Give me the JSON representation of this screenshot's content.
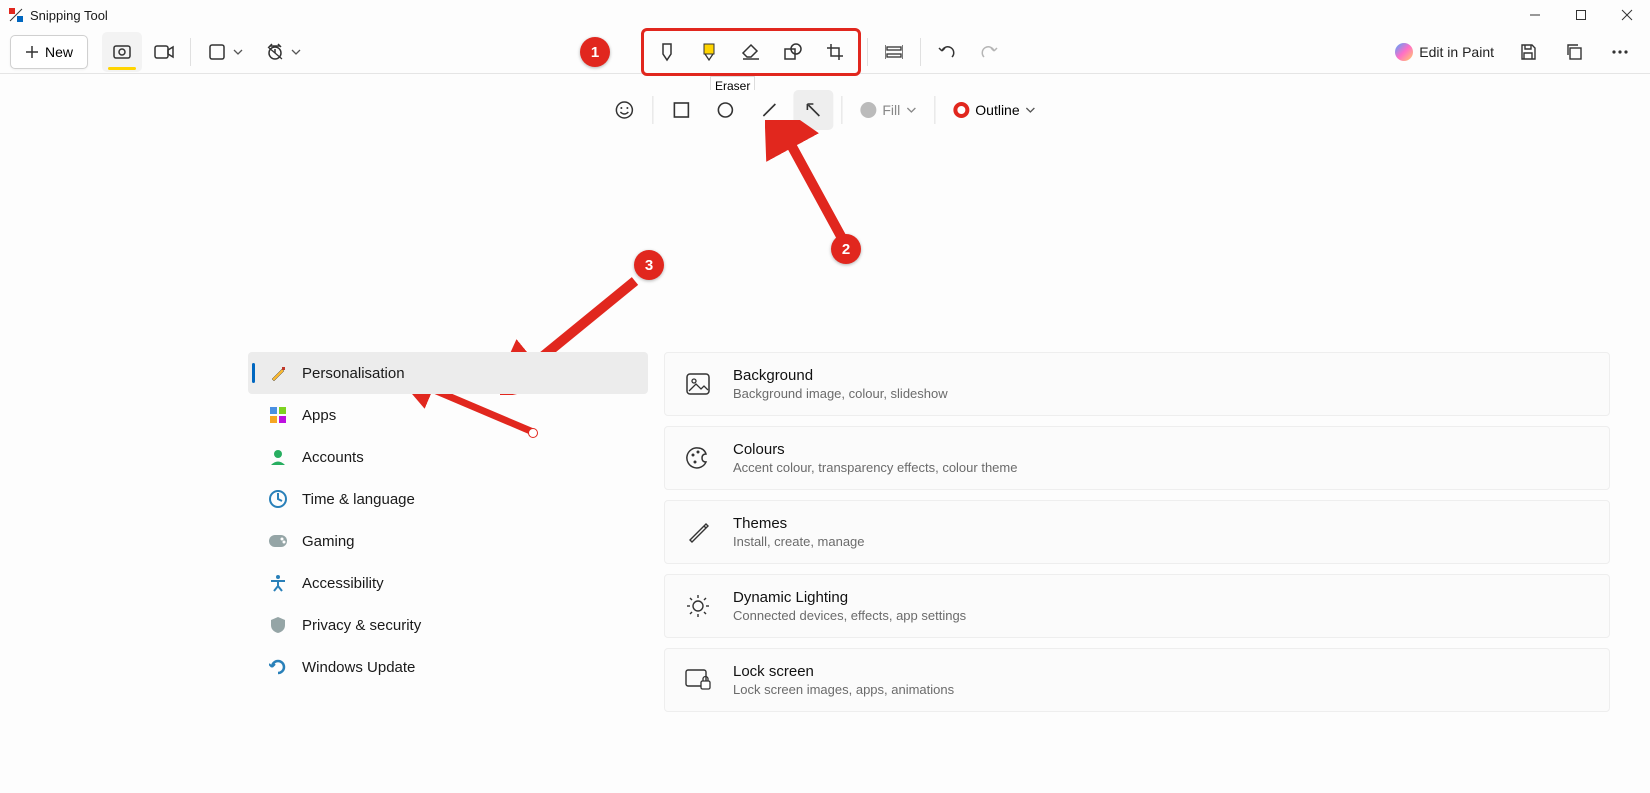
{
  "app": {
    "title": "Snipping Tool"
  },
  "toolbar": {
    "new_label": "New",
    "edit_paint_label": "Edit in Paint"
  },
  "tooltip": {
    "eraser": "Eraser"
  },
  "subbar": {
    "fill_label": "Fill",
    "outline_label": "Outline"
  },
  "callouts": {
    "one": "1",
    "two": "2",
    "three": "3"
  },
  "nav": {
    "items": [
      {
        "label": "Personalisation"
      },
      {
        "label": "Apps"
      },
      {
        "label": "Accounts"
      },
      {
        "label": "Time & language"
      },
      {
        "label": "Gaming"
      },
      {
        "label": "Accessibility"
      },
      {
        "label": "Privacy & security"
      },
      {
        "label": "Windows Update"
      }
    ]
  },
  "cards": [
    {
      "title": "Background",
      "sub": "Background image, colour, slideshow"
    },
    {
      "title": "Colours",
      "sub": "Accent colour, transparency effects, colour theme"
    },
    {
      "title": "Themes",
      "sub": "Install, create, manage"
    },
    {
      "title": "Dynamic Lighting",
      "sub": "Connected devices, effects, app settings"
    },
    {
      "title": "Lock screen",
      "sub": "Lock screen images, apps, animations"
    }
  ]
}
